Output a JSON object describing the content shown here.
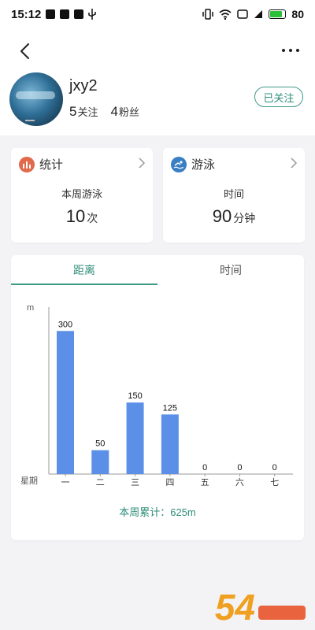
{
  "status_bar": {
    "time": "15:12",
    "battery": "80",
    "battery_level": 0.8
  },
  "header": {
    "username": "jxy2",
    "following_count": "5",
    "following_label": "关注",
    "followers_count": "4",
    "followers_label": "粉丝",
    "follow_button": "已关注"
  },
  "cards": {
    "stats": {
      "title": "统计",
      "subtitle": "本周游泳",
      "value": "10",
      "unit": "次"
    },
    "swim": {
      "title": "游泳",
      "subtitle": "时间",
      "value": "90",
      "unit": "分钟"
    }
  },
  "tabs": [
    {
      "label": "距离",
      "active": true
    },
    {
      "label": "时间",
      "active": false
    }
  ],
  "chart_data": {
    "type": "bar",
    "ylabel": "m",
    "xlabel": "星期",
    "categories": [
      "一",
      "二",
      "三",
      "四",
      "五",
      "六",
      "七"
    ],
    "values": [
      300,
      50,
      150,
      125,
      0,
      0,
      0
    ],
    "ylim": [
      0,
      350
    ],
    "bar_color": "#5b8fe8",
    "grid": false
  },
  "chart_total": "本周累计：625m",
  "colors": {
    "accent": "#3e9a86",
    "stats_icon_bg": "#e06a4a",
    "swim_icon_bg": "#3a7fc4"
  },
  "watermark": {
    "logo": "54"
  }
}
